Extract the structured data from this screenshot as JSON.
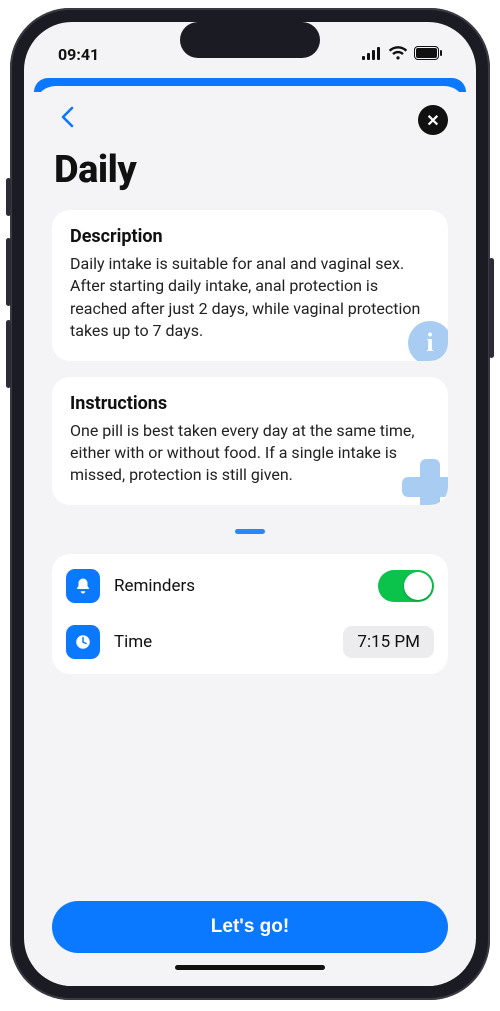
{
  "status": {
    "time": "09:41"
  },
  "page": {
    "title": "Daily"
  },
  "description": {
    "heading": "Description",
    "body": "Daily intake is suitable for anal and vaginal sex. After starting daily intake, anal protection is reached after just 2 days, while vaginal protection takes up to 7 days."
  },
  "instructions": {
    "heading": "Instructions",
    "body": "One pill is best taken every day at the same time, either with or without food. If a single intake is missed, protection is still given."
  },
  "settings": {
    "reminders_label": "Reminders",
    "reminders_on": true,
    "time_label": "Time",
    "time_value": "7:15 PM"
  },
  "cta": {
    "label": "Let's go!"
  },
  "icons": {
    "bell": "bell-icon",
    "clock": "clock-icon",
    "info": "i",
    "close": "✕",
    "back": "‹"
  }
}
